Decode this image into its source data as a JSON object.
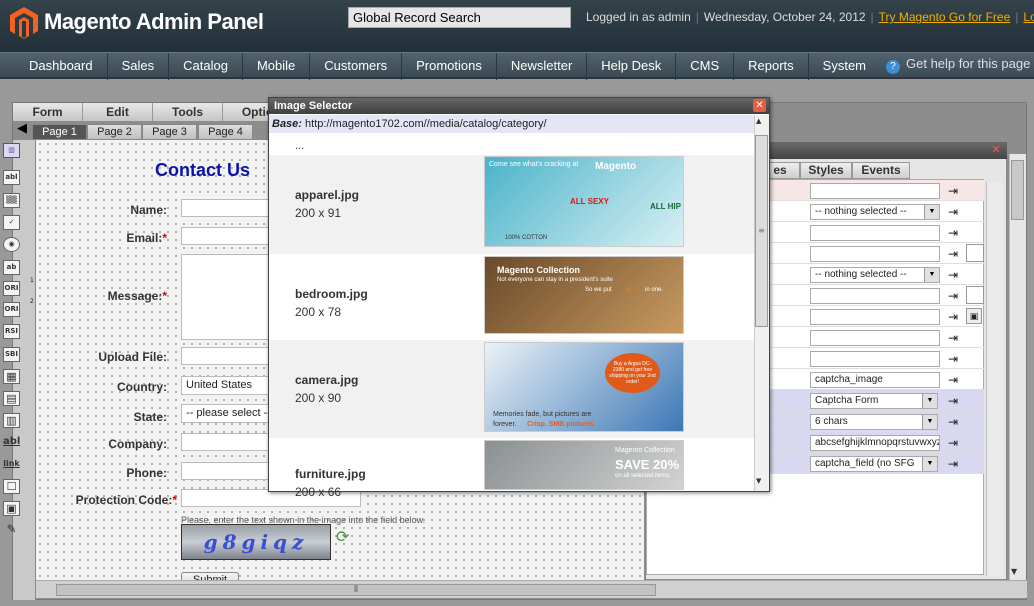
{
  "header": {
    "logo_text": "Magento Admin Panel",
    "search_value": "Global Record Search",
    "logged_in": "Logged in as admin",
    "date": "Wednesday, October 24, 2012",
    "try_link": "Try Magento Go for Free",
    "logout_link": "Log Out"
  },
  "nav": {
    "items": [
      "Dashboard",
      "Sales",
      "Catalog",
      "Mobile",
      "Customers",
      "Promotions",
      "Newsletter",
      "Help Desk",
      "CMS",
      "Reports",
      "System"
    ],
    "help": "Get help for this page"
  },
  "builder": {
    "menu": [
      "Form",
      "Edit",
      "Tools",
      "Optio"
    ],
    "pages": [
      "Page 1",
      "Page 2",
      "Page 3",
      "Page 4"
    ],
    "tools": [
      "abl",
      "▒▒",
      "✓",
      "◉",
      "ab",
      "ORI",
      "ORI",
      "RSI",
      "SBI",
      "▦",
      "▤",
      "▥",
      "abl",
      "link",
      "☐",
      "▣",
      "✎"
    ],
    "tool_superscripts": [
      "1",
      "2"
    ]
  },
  "form": {
    "title": "Contact Us",
    "fields": [
      {
        "label": "Name:",
        "required": false,
        "value": ""
      },
      {
        "label": "Email:",
        "required": true,
        "value": ""
      },
      {
        "label": "Message:",
        "required": true,
        "value": ""
      },
      {
        "label": "Upload File:",
        "required": false,
        "value": ""
      },
      {
        "label": "Country:",
        "required": false,
        "value": "United States"
      },
      {
        "label": "State:",
        "required": false,
        "value": "-- please select --"
      },
      {
        "label": "Company:",
        "required": false,
        "value": ""
      },
      {
        "label": "Phone:",
        "required": false,
        "value": ""
      },
      {
        "label": "Protection Code:",
        "required": true,
        "value": ""
      }
    ],
    "captcha_note": "Please, enter the text shown in the image into the field below.",
    "captcha_text": "g8giqz",
    "submit": "Submit"
  },
  "properties": {
    "tabs": [
      "es",
      "Styles",
      "Events"
    ],
    "rows": [
      {
        "value": "",
        "kind": "text"
      },
      {
        "value": "-- nothing selected --",
        "kind": "select"
      },
      {
        "value": "",
        "kind": "text"
      },
      {
        "value": "",
        "kind": "text",
        "extra": "check"
      },
      {
        "value": "-- nothing selected --",
        "kind": "select"
      },
      {
        "value": "",
        "kind": "text",
        "extra": "check"
      },
      {
        "value": "",
        "kind": "text",
        "extra": "image"
      },
      {
        "value": "",
        "kind": "text"
      },
      {
        "value": "",
        "kind": "text"
      },
      {
        "value": "captcha_image",
        "kind": "text"
      },
      {
        "value": "Captcha Form",
        "kind": "select",
        "highlight": true
      },
      {
        "value": "6 chars",
        "kind": "select",
        "highlight": true
      },
      {
        "value": "abcsefghijklmnopqrstuvwxyz",
        "kind": "text",
        "highlight": true
      },
      {
        "value": "captcha_field (no SFG",
        "kind": "select",
        "highlight": true
      }
    ]
  },
  "modal": {
    "title": "Image Selector",
    "base_label": "Base:",
    "base_url": "http://magento1702.com//media/catalog/category/",
    "parent": "...",
    "images": [
      {
        "name": "apparel.jpg",
        "size": "200 x 91",
        "banner": [
          "Come see what's cracking at",
          "Magento",
          "ALL SEXY",
          "ALL HIP",
          "100% COTTON"
        ],
        "colors": [
          "#4ab3c8",
          "#d8f0f4"
        ]
      },
      {
        "name": "bedroom.jpg",
        "size": "200 x 78",
        "banner": [
          "Magento Collection",
          "Not everyone can stay in a president's suite",
          "So we put",
          "all",
          "in one."
        ],
        "colors": [
          "#6a4a2a",
          "#c89a60"
        ]
      },
      {
        "name": "camera.jpg",
        "size": "200 x 90",
        "banner": [
          "Memories fade, but pictures are",
          "forever.",
          "Crisp. SMB pictures.",
          "Buy a Argus DC-2380 and get free shipping on your 2nd order!"
        ],
        "colors": [
          "#eaf2f7",
          "#3d78b5"
        ]
      },
      {
        "name": "furniture.jpg",
        "size": "200 x 66",
        "banner": [
          "Magento Collection",
          "SAVE 20%",
          "on all selected items"
        ],
        "colors": [
          "#8a8f92",
          "#d2d4d2"
        ]
      }
    ]
  },
  "colors": {
    "header_bg": "#2a3841",
    "link_accent": "#f0b000",
    "form_title": "#0c12a8",
    "required": "#dd0000",
    "modal_base_bg": "#e4e6f6"
  }
}
